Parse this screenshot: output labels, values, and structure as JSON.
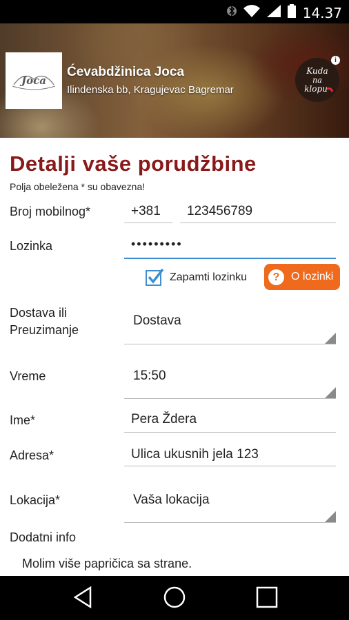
{
  "status_bar": {
    "time": "14.37",
    "icons": [
      "bluetooth-icon",
      "wifi-icon",
      "signal-icon",
      "battery-icon"
    ]
  },
  "header": {
    "restaurant_name": "Ćevabdžinica Joca",
    "restaurant_address": "Ilindenska bb, Kragujevac Bagremar",
    "logo_text": "Joca",
    "brand_badge_text": "Kuda na klopu"
  },
  "form": {
    "title": "Detalji vaše porudžbine",
    "required_note": "Polja obeležena * su obavezna!",
    "phone": {
      "label": "Broj mobilnog*",
      "prefix": "+381",
      "number": "123456789"
    },
    "password": {
      "label": "Lozinka",
      "value": "•••••••••"
    },
    "remember": {
      "label": "Zapamti lozinku",
      "checked": true
    },
    "about_password_button": "O lozinki",
    "delivery": {
      "label_line1": "Dostava ili",
      "label_line2": "Preuzimanje",
      "value": "Dostava"
    },
    "time": {
      "label": "Vreme",
      "value": "15:50"
    },
    "name": {
      "label": "Ime*",
      "value": "Pera Ždera"
    },
    "address": {
      "label": "Adresa*",
      "value": "Ulica ukusnih jela 123"
    },
    "location": {
      "label": "Lokacija*",
      "value": "Vaša lokacija"
    },
    "extra_info": {
      "label": "Dodatni info",
      "value": "Molim više papričica sa strane."
    }
  },
  "colors": {
    "title": "#8a1a1a",
    "accent": "#3d8fd1",
    "button": "#ef6a1c"
  }
}
